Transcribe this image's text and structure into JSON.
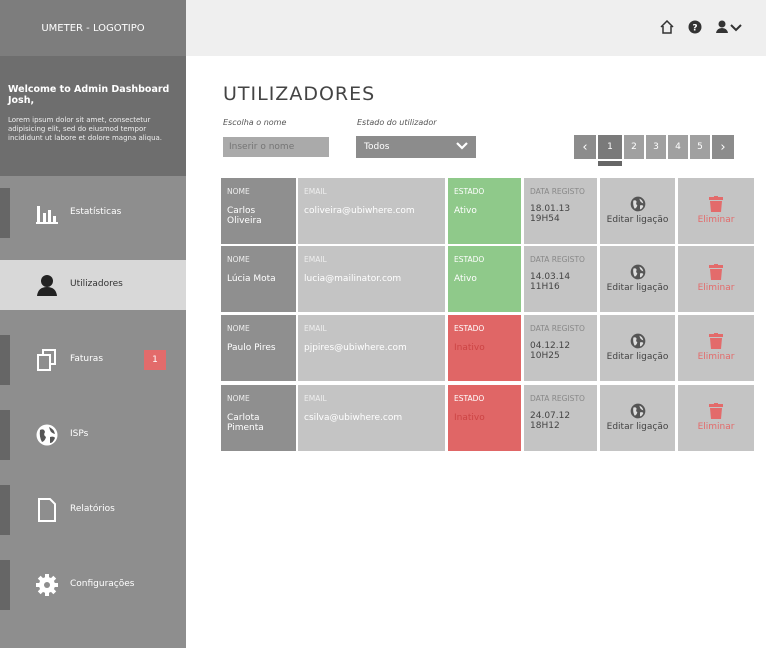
{
  "app": {
    "logo": "UMETER - LOGOTIPO"
  },
  "welcome": {
    "title": "Welcome to Admin Dashboard Josh,",
    "text": "Lorem ipsum dolor sit amet, consectetur adipisicing elit, sed do eiusmod tempor incididunt ut labore et dolore magna aliqua."
  },
  "sidebar": {
    "items": [
      {
        "label": "Estatísticas",
        "icon": "bar-chart-icon"
      },
      {
        "label": "Utilizadores",
        "icon": "user-icon"
      },
      {
        "label": "Faturas",
        "icon": "documents-icon",
        "badge": "1"
      },
      {
        "label": "ISPs",
        "icon": "globe-icon"
      },
      {
        "label": "Relatórios",
        "icon": "file-icon"
      },
      {
        "label": "Configurações",
        "icon": "gear-icon"
      }
    ]
  },
  "page": {
    "title": "UTILIZADORES"
  },
  "filters": {
    "name_label": "Escolha o nome",
    "name_placeholder": "Inserir o nome",
    "estado_label": "Estado do utilizador",
    "estado_value": "Todos"
  },
  "pagination": {
    "prev": "‹",
    "next": "›",
    "pages": [
      "1",
      "2",
      "3",
      "4",
      "5"
    ],
    "current": "1"
  },
  "table": {
    "headers": {
      "nome": "NOME",
      "email": "EMAIL",
      "estado": "ESTADO",
      "data": "DATA REGISTO"
    },
    "edit_label": "Editar ligação",
    "delete_label": "Eliminar",
    "rows": [
      {
        "name": "Carlos Oliveira",
        "email": "coliveira@ubiwhere.com",
        "estado": "Ativo",
        "date": "18.01.13",
        "time": "19H54",
        "status_color": "#8fc98a"
      },
      {
        "name": "Lúcia Mota",
        "email": "lucia@mailinator.com",
        "estado": "Ativo",
        "date": "14.03.14",
        "time": "11H16",
        "status_color": "#8fc98a"
      },
      {
        "name": "Paulo Pires",
        "email": "pjpires@ubiwhere.com",
        "estado": "Inativo",
        "date": "04.12.12",
        "time": "10H25",
        "status_color": "#e06666"
      },
      {
        "name": "Carlota Pimenta",
        "email": "csilva@ubiwhere.com",
        "estado": "Inativo",
        "date": "24.07.12",
        "time": "18H12",
        "status_color": "#e06666"
      }
    ]
  }
}
